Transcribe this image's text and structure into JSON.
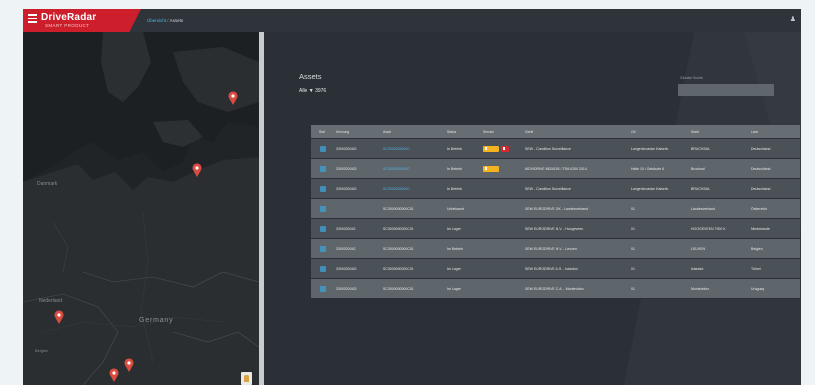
{
  "app": {
    "brand": "DriveRadar",
    "brand_sub": "SMART PRODUCT",
    "breadcrumb": [
      "Übersicht",
      "Assets"
    ],
    "breadcrumb_sep": "/"
  },
  "map": {
    "labels": {
      "denmark": "Danmark",
      "netherlands": "Nederland",
      "belgium": "Belgien",
      "germany": "Germany"
    }
  },
  "assets": {
    "title": "Assets",
    "count_line": "Alle ▼ 3976",
    "filter_label": "Globale Suche",
    "filter_placeholder": ""
  },
  "table": {
    "columns": [
      "Stat",
      "Kennung",
      "Asset",
      "Status",
      "Service",
      "Gerät",
      "Ort",
      "Stadt",
      "Land"
    ],
    "rows": [
      {
        "kennung": "3300320042I",
        "asset": "SC3000005000C",
        "status": "In Betrieb",
        "badges": [
          "yellow",
          "red"
        ],
        "geraet": "SEW - Condition Surveillance",
        "ort": "Langenbruecke Kaiserb.",
        "stadt": "BRUCHSAL",
        "land": "Deutschland"
      },
      {
        "kennung": "3300320042I",
        "asset": "SC3000005000C",
        "status": "In Betrieb",
        "badges": [
          "yellow"
        ],
        "geraet": "MOVIDRIVE MDX61B / TRA 0200 2014",
        "ort": "Halle 10 / Gebäude 6",
        "stadt": "Bruchsal",
        "land": "Deutschland"
      },
      {
        "kennung": "3300320042I",
        "asset": "SC3000005000C",
        "status": "In Betrieb",
        "badges": [],
        "geraet": "SEW - Condition Surveillance",
        "ort": "Langenbruecke Kaiserb.",
        "stadt": "BRUCHSAL",
        "land": "Deutschland"
      },
      {
        "kennung": "",
        "asset": "SC3000000000C01",
        "status": "Unbekannt",
        "badges": [],
        "geraet": "SEW EURODRIVE GK - Landesverband",
        "ort": "01",
        "stadt": "Landesverband",
        "land": "Österreich"
      },
      {
        "kennung": "3300320042",
        "asset": "SC3000000000C01",
        "status": "Im Lager",
        "badges": [],
        "geraet": "SEW EURODRIVE N.V. - Hoogeveen",
        "ort": "01",
        "stadt": "HOOGEVEEN 7900 K",
        "land": "Niederlande"
      },
      {
        "kennung": "3300320042",
        "asset": "SC3000000000C01",
        "status": "Im Betrieb",
        "badges": [],
        "geraet": "SEW EURODRIVE N.V. - Leuven",
        "ort": "01",
        "stadt": "LEUVEN",
        "land": "Belgien"
      },
      {
        "kennung": "3300320042I",
        "asset": "SC3000000000C01",
        "status": "Im Lager",
        "badges": [],
        "geraet": "SEW EURODRIVE A.S. - Istanbul",
        "ort": "01",
        "stadt": "Istanbul",
        "land": "Türkei"
      },
      {
        "kennung": "3300320042I",
        "asset": "SC3000000000C01",
        "status": "Im Lager",
        "badges": [],
        "geraet": "SEW EURODRIVE C.A. - Montevideo",
        "ort": "01",
        "stadt": "Montevideo",
        "land": "Uruguay"
      }
    ]
  },
  "colors": {
    "brand_red": "#cc1f2b",
    "link_blue": "#4fb3e3",
    "badge_yellow": "#f4b31f",
    "badge_red": "#d9262f"
  }
}
